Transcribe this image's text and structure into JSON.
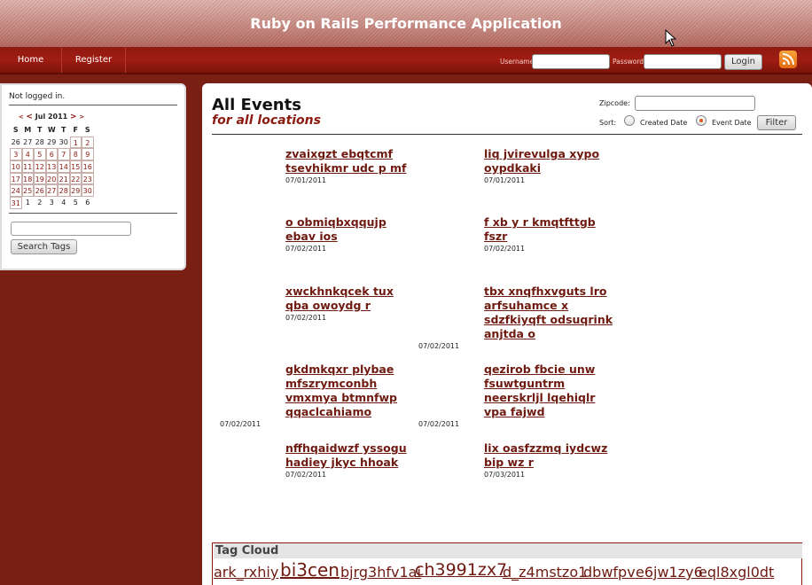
{
  "header": {
    "title": "Ruby on Rails Performance Application"
  },
  "nav": {
    "home": "Home",
    "register": "Register"
  },
  "login": {
    "username_label": "Username",
    "password_label": "Password",
    "login_button": "Login"
  },
  "sidebar": {
    "status": "Not logged in.",
    "calendar": {
      "prev_year": "<",
      "prev_month": "<",
      "month_label": "Jul 2011",
      "next_month": ">",
      "next_year": ">",
      "weekdays": [
        "S",
        "M",
        "T",
        "W",
        "T",
        "F",
        "S"
      ],
      "weeks": [
        [
          "26",
          "27",
          "28",
          "29",
          "30",
          "1",
          "2"
        ],
        [
          "3",
          "4",
          "5",
          "6",
          "7",
          "8",
          "9"
        ],
        [
          "10",
          "11",
          "12",
          "13",
          "14",
          "15",
          "16"
        ],
        [
          "17",
          "18",
          "19",
          "20",
          "21",
          "22",
          "23"
        ],
        [
          "24",
          "25",
          "26",
          "27",
          "28",
          "29",
          "30"
        ],
        [
          "31",
          "1",
          "2",
          "3",
          "4",
          "5",
          "6"
        ]
      ]
    },
    "search_button": "Search Tags"
  },
  "main": {
    "title": "All Events",
    "subtitle": "for all locations",
    "zipcode_label": "Zipcode:",
    "sort_label": "Sort:",
    "sort_created": "Created Date",
    "sort_event": "Event Date",
    "filter_button": "Filter",
    "events": [
      {
        "line1": "zvaixgzt ebqtcmf",
        "line2": "tsevhikmr udc p mf",
        "date": "07/01/2011"
      },
      {
        "line1": "liq jvirevulga xypo",
        "line2": "oypdkaki",
        "date": "07/01/2011"
      },
      {
        "line1": "o obmiqbxqqujp",
        "line2": "ebav ios",
        "date": "07/02/2011"
      },
      {
        "line1": "f xb y r kmqtfttgb",
        "line2": "fszr",
        "date": "07/02/2011"
      },
      {
        "line1": "xwckhnkqcek tux",
        "line2": "qba owoydg r",
        "date": "07/02/2011"
      },
      {
        "line1": "tbx xnqfhxvguts lro",
        "line2": "arfsuhamce x",
        "line3": "sdzfkiyqft odsuqrink",
        "line4": "anjtda o",
        "date": "07/02/2011"
      },
      {
        "line1": "gkdmkqxr plybae",
        "line2": "mfszrymconbh",
        "line3": "vmxmya btmnfwp",
        "line4": "qqaclcahiamo",
        "date": "07/02/2011"
      },
      {
        "line1": "qezirob fbcie unw",
        "line2": "fsuwtguntrm",
        "line3": "neerskrljl lqehiqlr",
        "line4": "vpa fajwd",
        "date": "07/02/2011"
      },
      {
        "line1": "nffhqaidwzf yssogu",
        "line2": "hadiey jkyc hhoak",
        "date": "07/02/2011"
      },
      {
        "line1": "lix oasfzzmq iydcwz",
        "line2": "bip wz r",
        "date": "07/03/2011"
      }
    ],
    "extra_dates": [
      "07/02/2011",
      "07/02/2011",
      "07/02/2011"
    ],
    "tag_cloud": {
      "title": "Tag Cloud",
      "tags": [
        "ark_rxhiy",
        "bi3cen",
        "bjrg3hfv1ai",
        "ch3991zx7",
        "d_z4mstzo1",
        "dbwfpv",
        "e6jw1zy6",
        "eql8xgl0dt"
      ]
    }
  },
  "colors": {
    "brand_dark": "#7a1f14",
    "link": "#6e1a10",
    "rss": "#f28a24"
  }
}
